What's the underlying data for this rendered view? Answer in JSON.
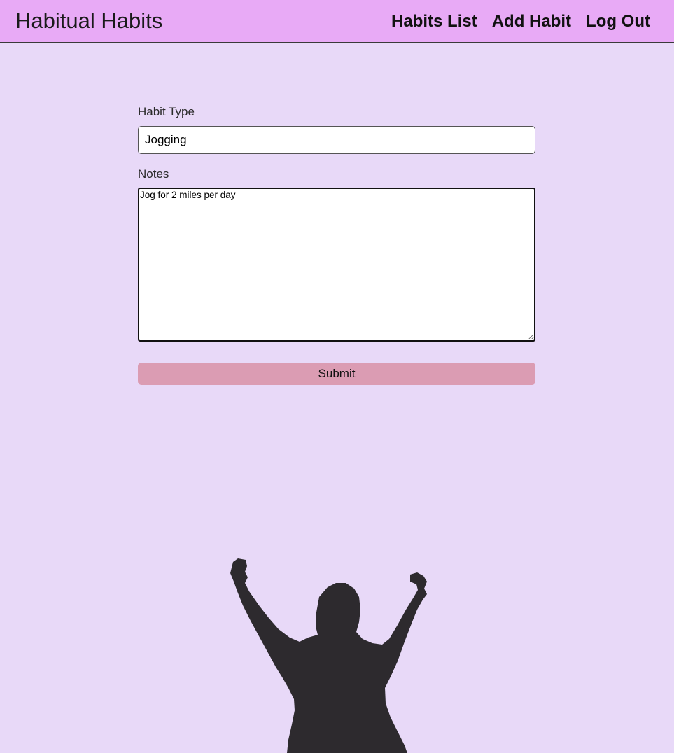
{
  "app": {
    "title": "Habitual Habits"
  },
  "nav": {
    "items": [
      {
        "label": "Habits List"
      },
      {
        "label": "Add Habit"
      },
      {
        "label": "Log Out"
      }
    ]
  },
  "form": {
    "habit_type_label": "Habit Type",
    "habit_type_value": "Jogging",
    "notes_label": "Notes",
    "notes_value": "Jog for 2 miles per day",
    "submit_label": "Submit"
  },
  "colors": {
    "background": "#e8d9f8",
    "navbar": "#e8aaf6",
    "submit_button": "#db9cb3",
    "silhouette": "#2d2a2e"
  },
  "illustration": {
    "icon": "celebrating-person-silhouette"
  }
}
